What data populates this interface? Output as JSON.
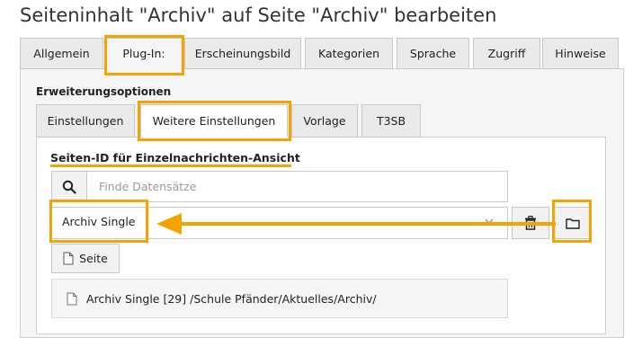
{
  "page_title": "Seiteninhalt \"Archiv\" auf Seite \"Archiv\" bearbeiten",
  "main_tabs": [
    {
      "label": "Allgemein"
    },
    {
      "label": "Plug-In:"
    },
    {
      "label": "Erscheinungsbild"
    },
    {
      "label": "Kategorien"
    },
    {
      "label": "Sprache"
    },
    {
      "label": "Zugriff"
    },
    {
      "label": "Hinweise"
    }
  ],
  "active_main_tab": "Plug-In:",
  "section_heading": "Erweiterungsoptionen",
  "sub_tabs": [
    {
      "label": "Einstellungen"
    },
    {
      "label": "Weitere Einstellungen"
    },
    {
      "label": "Vorlage"
    },
    {
      "label": "T3SB"
    }
  ],
  "active_sub_tab": "Weitere Einstellungen",
  "field": {
    "label": "Seiten-ID für Einzelnachrichten-Ansicht",
    "search_placeholder": "Finde Datensätze",
    "selected_value": "Archiv Single",
    "page_button_label": "Seite",
    "record": {
      "title": "Archiv Single",
      "uid": "[29]",
      "path": "/Schule Pfänder/Aktuelles/Archiv/"
    }
  },
  "icons": [
    "search-icon",
    "chevron-down-icon",
    "trash-icon",
    "folder-icon",
    "page-icon"
  ],
  "colors": {
    "highlight": "#f5a300",
    "panel_bg": "#f5f5f5",
    "border": "#c8c8c8"
  }
}
